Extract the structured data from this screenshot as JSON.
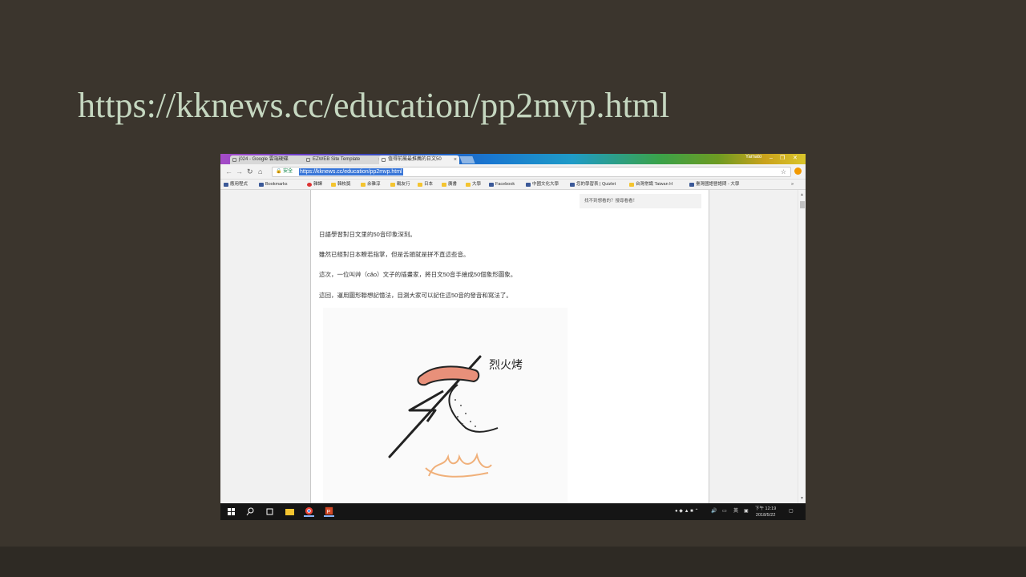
{
  "slide": {
    "title": "https://kknews.cc/education/pp2mvp.html"
  },
  "browser": {
    "tabs": [
      {
        "label": "j024 - Google 雲端硬碟",
        "active": false
      },
      {
        "label": "EZWEB Site Template",
        "active": false
      },
      {
        "label": "值得前屬最推薦的日文50",
        "active": true
      }
    ],
    "user": "Yamato",
    "window_controls": {
      "minimize": "–",
      "restore": "❐",
      "close": "✕"
    },
    "nav": {
      "back": "←",
      "forward": "→",
      "reload": "↻",
      "home": "⌂"
    },
    "secure_label": "安全",
    "url": "https://kknews.cc/education/pp2mvp.html",
    "star": "☆",
    "bookmarks": [
      "應用程式",
      "Bookmarks",
      "雜譯",
      "韓枚獎",
      "余雜淳",
      "戰友行",
      "日本",
      "廣書",
      "大學",
      "Facebook",
      "中國文化大學",
      "您的學習表 | Quizlet",
      "台灣常識 Taiwan H",
      "臺灣國語營語問 - 大學"
    ],
    "bookmark_more": "»"
  },
  "article": {
    "side_box": "找不到想看的？搜尋看看！",
    "paragraphs": [
      "日語學習對日文里的50音印象深刻。",
      "雖然已經對日本瞭若指掌，但是舌頭就是拼不直這些音。",
      "這次，一位叫艸（cǎo）文子的插畫家，將日文50音手繪成50個象形圖象。",
      "這回，運用圖形聯想記憶法，目測大家可以記住這50音的發音和寫法了。"
    ],
    "illustration_caption": "烈火烤"
  },
  "taskbar": {
    "tray_text": "英",
    "time": "下午 12:19",
    "date": "2018/5/22"
  },
  "colors": {
    "slide_bg": "#3b352d",
    "title": "#c5d7c0",
    "url_highlight": "#3875d7",
    "sausage": "#e8907a",
    "flame": "#f0b07a"
  }
}
